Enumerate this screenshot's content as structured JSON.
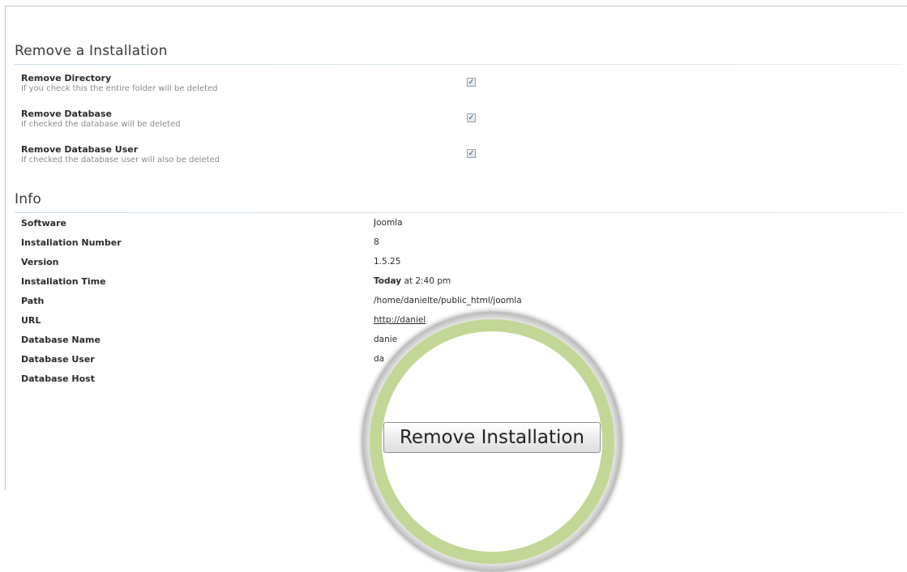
{
  "remove_section": {
    "title": "Remove a Installation",
    "options": [
      {
        "label": "Remove Directory",
        "description": "If you check this the entire folder will be deleted",
        "checked": true
      },
      {
        "label": "Remove Database",
        "description": "If checked the database will be deleted",
        "checked": true
      },
      {
        "label": "Remove Database User",
        "description": "If checked the database user will also be deleted",
        "checked": true
      }
    ]
  },
  "info_section": {
    "title": "Info",
    "rows": [
      {
        "label": "Software",
        "value": "Joomla"
      },
      {
        "label": "Installation Number",
        "value": "8"
      },
      {
        "label": "Version",
        "value": "1.5.25"
      },
      {
        "label": "Installation Time",
        "value_bold": "Today",
        "value": " at 2:40 pm"
      },
      {
        "label": "Path",
        "value": "/home/danielte/public_html/joomla"
      },
      {
        "label": "URL",
        "value": "http://daniel"
      },
      {
        "label": "Database Name",
        "value": "danie"
      },
      {
        "label": "Database User",
        "value": "da"
      },
      {
        "label": "Database Host",
        "value": ""
      }
    ]
  },
  "checkmark": "✓",
  "remove_button": {
    "label": "Remove Installation"
  },
  "colors": {
    "lens_ring": "#c2d795",
    "rule": "#c9dbe6"
  }
}
